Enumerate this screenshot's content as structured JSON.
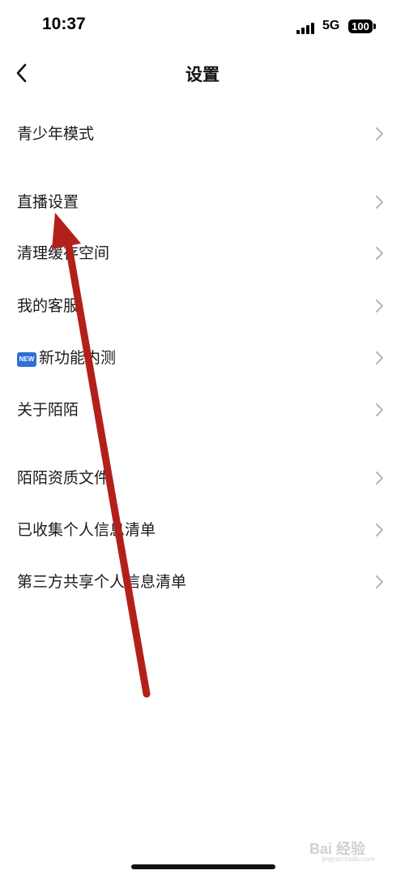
{
  "status_bar": {
    "time": "10:37",
    "network": "5G",
    "battery": "100"
  },
  "header": {
    "title": "设置",
    "back_icon": "chevron-left-icon"
  },
  "settings": {
    "items": [
      {
        "label": "青少年模式"
      },
      {
        "label": "直播设置"
      },
      {
        "label": "清理缓存空间"
      },
      {
        "label": "我的客服"
      },
      {
        "label": "新功能内测",
        "badge": "NEW"
      },
      {
        "label": "关于陌陌"
      },
      {
        "label": "陌陌资质文件"
      },
      {
        "label": "已收集个人信息清单"
      },
      {
        "label": "第三方共享个人信息清单"
      }
    ]
  },
  "annotation": {
    "icon": "red-arrow-annotation",
    "color": "#b3201c"
  },
  "watermark": {
    "text": "Bai 经验",
    "sub": "jingyan.baidu.com"
  },
  "colors": {
    "chevron": "#b5b5b5",
    "text": "#1b1b1b",
    "badge": "#2f6fd6"
  }
}
